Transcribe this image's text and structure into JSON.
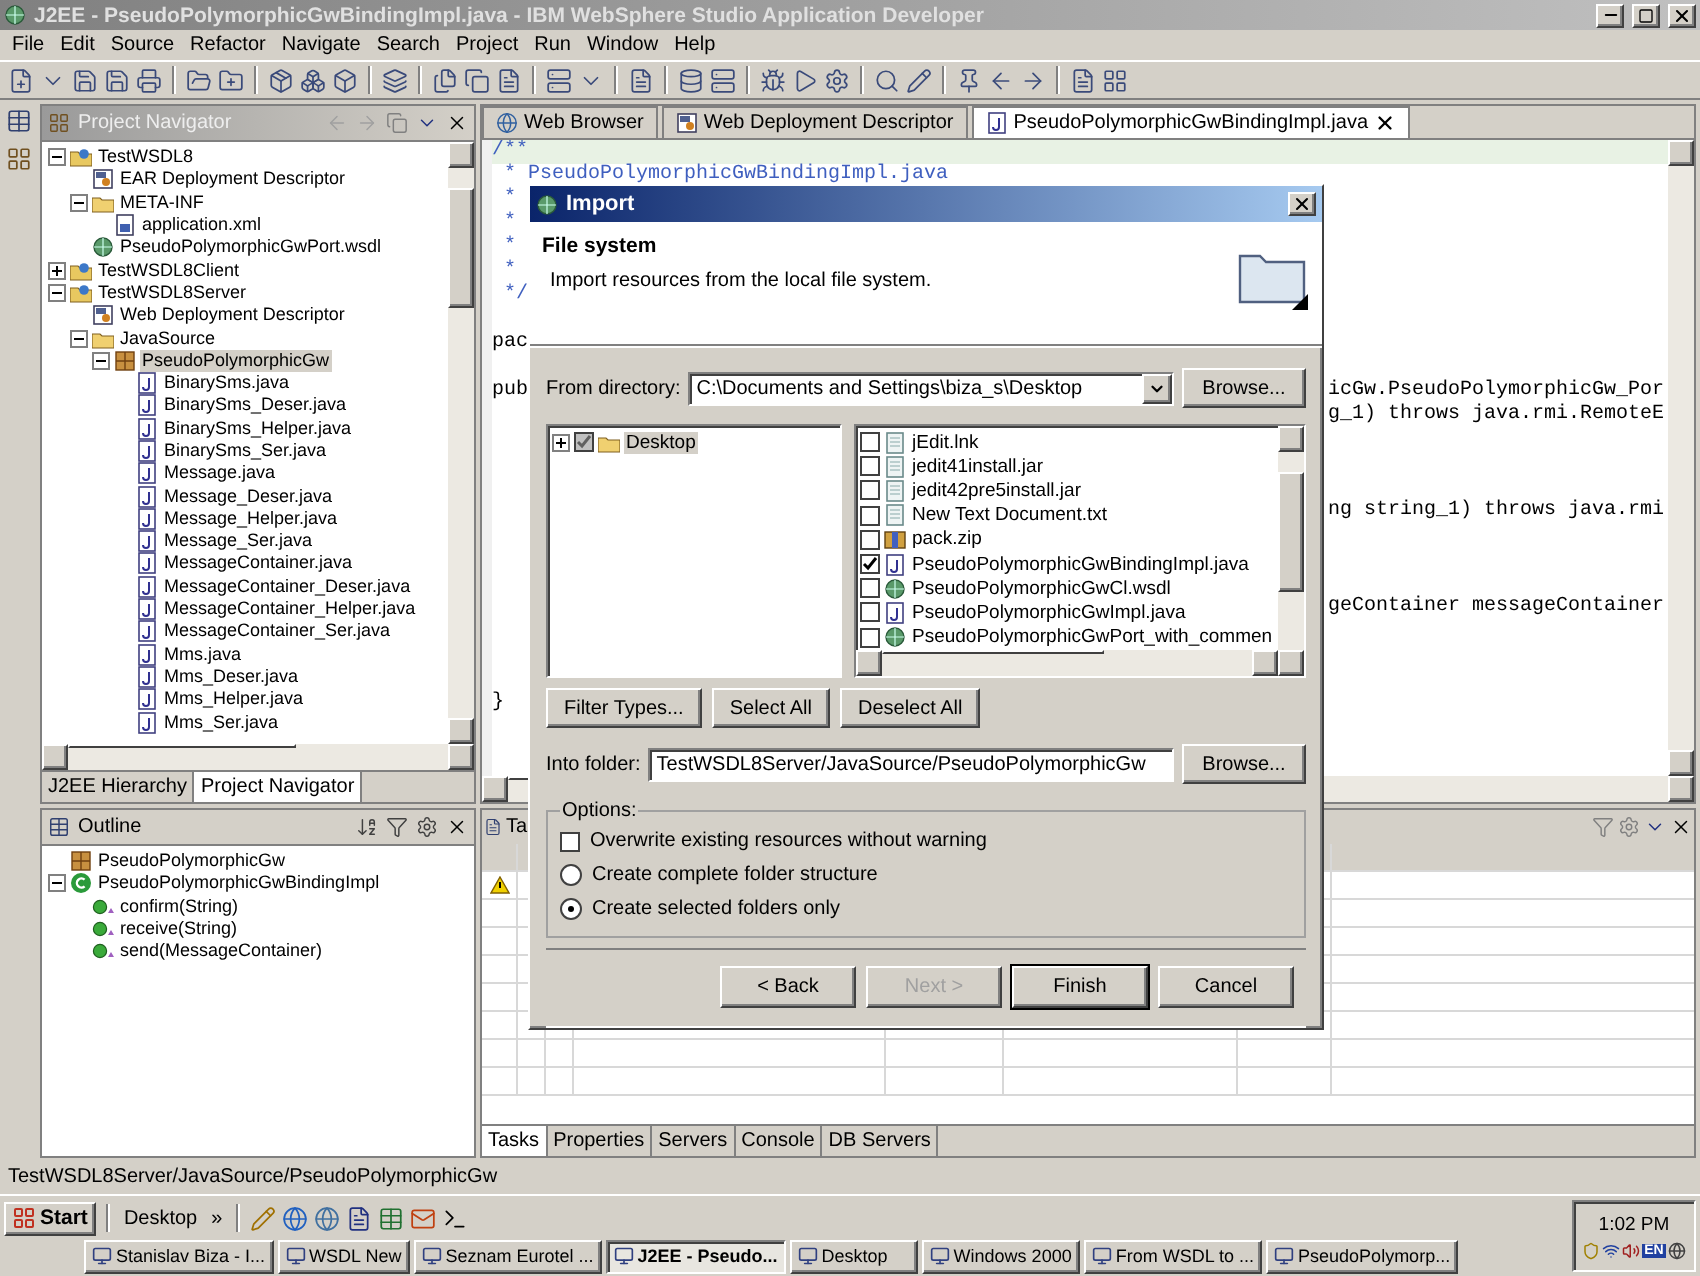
{
  "window": {
    "title": "J2EE - PseudoPolymorphicGwBindingImpl.java - IBM WebSphere Studio Application Developer"
  },
  "menu": [
    "File",
    "Edit",
    "Source",
    "Refactor",
    "Navigate",
    "Search",
    "Project",
    "Run",
    "Window",
    "Help"
  ],
  "navigator": {
    "title": "Project Navigator",
    "tree": [
      {
        "label": "TestWSDL8",
        "kind": "project",
        "expanded": true,
        "selected": false,
        "children": [
          {
            "label": "EAR Deployment Descriptor",
            "kind": "descriptor",
            "selected": false
          },
          {
            "label": "META-INF",
            "kind": "folder",
            "expanded": true,
            "selected": false,
            "children": [
              {
                "label": "application.xml",
                "kind": "xml",
                "selected": false
              }
            ]
          },
          {
            "label": "PseudoPolymorphicGwPort.wsdl",
            "kind": "wsdl",
            "selected": false
          }
        ]
      },
      {
        "label": "TestWSDL8Client",
        "kind": "project",
        "expanded": false,
        "selected": false
      },
      {
        "label": "TestWSDL8Server",
        "kind": "project",
        "expanded": true,
        "selected": false,
        "children": [
          {
            "label": "Web Deployment Descriptor",
            "kind": "descriptor",
            "selected": false
          },
          {
            "label": "JavaSource",
            "kind": "folder",
            "expanded": true,
            "selected": false,
            "children": [
              {
                "label": "PseudoPolymorphicGw",
                "kind": "package",
                "expanded": true,
                "selected": true,
                "children": [
                  {
                    "label": "BinarySms.java",
                    "kind": "java",
                    "selected": false
                  },
                  {
                    "label": "BinarySms_Deser.java",
                    "kind": "java",
                    "selected": false
                  },
                  {
                    "label": "BinarySms_Helper.java",
                    "kind": "java",
                    "selected": false
                  },
                  {
                    "label": "BinarySms_Ser.java",
                    "kind": "java",
                    "selected": false
                  },
                  {
                    "label": "Message.java",
                    "kind": "java",
                    "selected": false
                  },
                  {
                    "label": "Message_Deser.java",
                    "kind": "java",
                    "selected": false
                  },
                  {
                    "label": "Message_Helper.java",
                    "kind": "java",
                    "selected": false
                  },
                  {
                    "label": "Message_Ser.java",
                    "kind": "java",
                    "selected": false
                  },
                  {
                    "label": "MessageContainer.java",
                    "kind": "java",
                    "selected": false
                  },
                  {
                    "label": "MessageContainer_Deser.java",
                    "kind": "java",
                    "selected": false
                  },
                  {
                    "label": "MessageContainer_Helper.java",
                    "kind": "java",
                    "selected": false
                  },
                  {
                    "label": "MessageContainer_Ser.java",
                    "kind": "java",
                    "selected": false
                  },
                  {
                    "label": "Mms.java",
                    "kind": "java",
                    "selected": false
                  },
                  {
                    "label": "Mms_Deser.java",
                    "kind": "java",
                    "selected": false
                  },
                  {
                    "label": "Mms_Helper.java",
                    "kind": "java",
                    "selected": false
                  },
                  {
                    "label": "Mms_Ser.java",
                    "kind": "java",
                    "selected": false
                  }
                ]
              }
            ]
          }
        ]
      }
    ],
    "tabs": [
      {
        "label": "J2EE Hierarchy",
        "selected": false
      },
      {
        "label": "Project Navigator",
        "selected": true
      }
    ]
  },
  "outline": {
    "title": "Outline",
    "tree": [
      {
        "label": "PseudoPolymorphicGw",
        "kind": "package",
        "selected": false
      },
      {
        "label": "PseudoPolymorphicGwBindingImpl",
        "kind": "class",
        "expanded": true,
        "selected": false,
        "children": [
          {
            "label": "confirm(String)",
            "kind": "method",
            "selected": false
          },
          {
            "label": "receive(String)",
            "kind": "method",
            "selected": false
          },
          {
            "label": "send(MessageContainer)",
            "kind": "method",
            "selected": false
          }
        ]
      }
    ]
  },
  "editor": {
    "tabs": [
      {
        "label": "Web Browser",
        "kind": "browser",
        "selected": false
      },
      {
        "label": "Web Deployment Descriptor",
        "kind": "descriptor",
        "selected": false
      },
      {
        "label": "PseudoPolymorphicGwBindingImpl.java",
        "kind": "java",
        "selected": true
      }
    ],
    "lines": [
      {
        "kind": "comment",
        "left": "/**",
        "current": true
      },
      {
        "kind": "comment",
        "left": " * PseudoPolymorphicGwBindingImpl.java",
        "current": false
      },
      {
        "kind": "comment",
        "left": " *",
        "current": false
      },
      {
        "kind": "comment",
        "left": " *",
        "current": false
      },
      {
        "kind": "comment",
        "left": " *",
        "current": false
      },
      {
        "kind": "comment",
        "left": " *",
        "current": false
      },
      {
        "kind": "comment",
        "left": " */",
        "current": false
      },
      {
        "kind": "blank",
        "current": false
      },
      {
        "kind": "code",
        "left": "pac",
        "current": false
      },
      {
        "kind": "blank",
        "current": false
      },
      {
        "kind": "code",
        "left": "pub",
        "right": "icGw.PseudoPolymorphicGw_Por",
        "current": false
      },
      {
        "kind": "code",
        "right": "g_1) throws java.rmi.RemoteE",
        "current": false
      },
      {
        "kind": "blank",
        "current": false
      },
      {
        "kind": "blank",
        "current": false
      },
      {
        "kind": "blank",
        "current": false
      },
      {
        "kind": "code",
        "right": "ng string_1) throws java.rmi",
        "current": false
      },
      {
        "kind": "blank",
        "current": false
      },
      {
        "kind": "blank",
        "current": false
      },
      {
        "kind": "blank",
        "current": false
      },
      {
        "kind": "code",
        "right": "geContainer messageContainer",
        "current": false
      },
      {
        "kind": "blank",
        "current": false
      },
      {
        "kind": "blank",
        "current": false
      },
      {
        "kind": "blank",
        "current": false
      },
      {
        "kind": "code",
        "left": "}",
        "current": false
      }
    ]
  },
  "tasks": {
    "title": "Ta",
    "tabs": [
      {
        "label": "Tasks",
        "selected": true
      },
      {
        "label": "Properties",
        "selected": false
      },
      {
        "label": "Servers",
        "selected": false
      },
      {
        "label": "Console",
        "selected": false
      },
      {
        "label": "DB Servers",
        "selected": false
      }
    ]
  },
  "status_bar": "TestWSDL8Server/JavaSource/PseudoPolymorphicGw",
  "dialog": {
    "title": "Import",
    "heading": "File system",
    "description": "Import resources from the local file system.",
    "from_label": "From directory:",
    "from_value": "C:\\Documents and Settings\\biza_s\\Desktop",
    "from_browse": "Browse...",
    "folders": [
      {
        "label": "Desktop",
        "checked": true,
        "greyed": true,
        "expanded": false,
        "selected": true
      }
    ],
    "files": [
      {
        "label": "jEdit.lnk",
        "kind": "file",
        "checked": false
      },
      {
        "label": "jedit41install.jar",
        "kind": "file",
        "checked": false
      },
      {
        "label": "jedit42pre5install.jar",
        "kind": "file",
        "checked": false
      },
      {
        "label": "New Text Document.txt",
        "kind": "file",
        "checked": false
      },
      {
        "label": "pack.zip",
        "kind": "zip",
        "checked": false
      },
      {
        "label": "PseudoPolymorphicGwBindingImpl.java",
        "kind": "java",
        "checked": true
      },
      {
        "label": "PseudoPolymorphicGwCl.wsdl",
        "kind": "wsdl",
        "checked": false
      },
      {
        "label": "PseudoPolymorphicGwImpl.java",
        "kind": "java",
        "checked": false
      },
      {
        "label": "PseudoPolymorphicGwPort_with_commen",
        "kind": "wsdl",
        "checked": false
      }
    ],
    "filter_buttons": [
      "Filter Types...",
      "Select All",
      "Deselect All"
    ],
    "into_label": "Into folder:",
    "into_value": "TestWSDL8Server/JavaSource/PseudoPolymorphicGw",
    "into_browse": "Browse...",
    "options": {
      "title": "Options:",
      "items": [
        {
          "kind": "checkbox",
          "label": "Overwrite existing resources without warning",
          "checked": false
        },
        {
          "kind": "radio",
          "label": "Create complete folder structure",
          "selected": false
        },
        {
          "kind": "radio",
          "label": "Create selected folders only",
          "selected": true
        }
      ]
    },
    "buttons": [
      {
        "label": "< Back",
        "disabled": false,
        "default": false
      },
      {
        "label": "Next >",
        "disabled": true,
        "default": false
      },
      {
        "label": "Finish",
        "disabled": false,
        "default": true
      },
      {
        "label": "Cancel",
        "disabled": false,
        "default": false
      }
    ]
  },
  "taskbar": {
    "start": "Start",
    "toolbar_label": "Desktop",
    "chevron": "»",
    "time": "1:02 PM",
    "language": "EN",
    "tasks": [
      {
        "label": "Stanislav Biza - I...",
        "selected": false
      },
      {
        "label": "WSDL New",
        "selected": false
      },
      {
        "label": "Seznam Eurotel ...",
        "selected": false
      },
      {
        "label": "J2EE - Pseudo...",
        "selected": true
      },
      {
        "label": "Desktop",
        "selected": false
      },
      {
        "label": "Windows 2000",
        "selected": false
      },
      {
        "label": "From WSDL to ...",
        "selected": false
      },
      {
        "label": "PseudoPolymorp...",
        "selected": false
      }
    ]
  }
}
